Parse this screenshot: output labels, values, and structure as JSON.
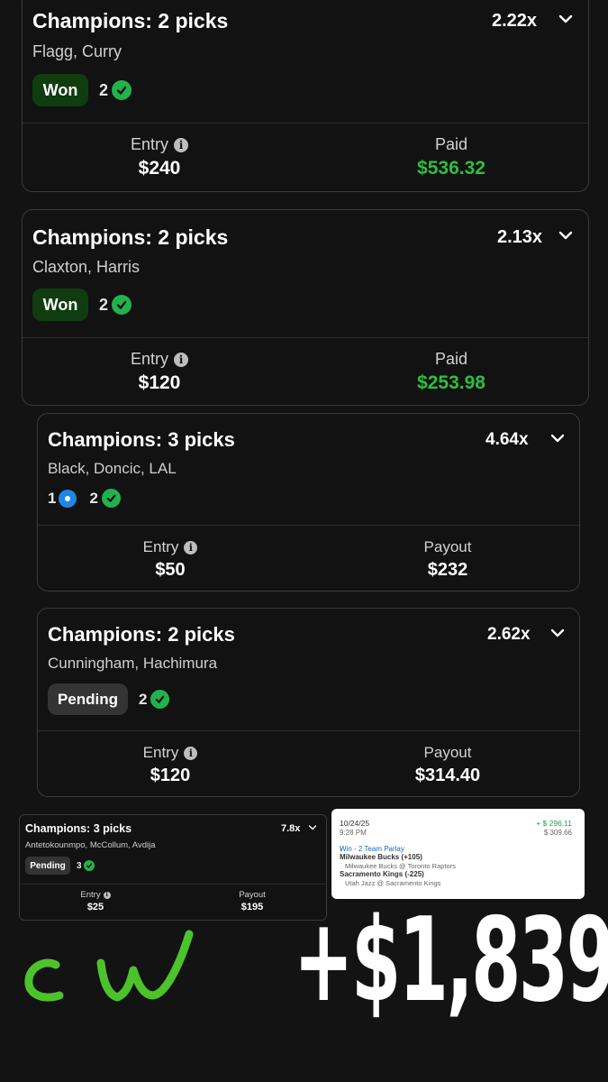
{
  "cards": [
    {
      "title": "Champions: 2 picks",
      "multiplier": "2.22x",
      "players": "Flagg, Curry",
      "badge": "Won",
      "pending_count": "",
      "check_count": "2",
      "entry_label": "Entry",
      "entry_value": "$240",
      "result_label": "Paid",
      "result_value": "$536.32"
    },
    {
      "title": "Champions: 2 picks",
      "multiplier": "2.13x",
      "players": "Claxton, Harris",
      "badge": "Won",
      "pending_count": "",
      "check_count": "2",
      "entry_label": "Entry",
      "entry_value": "$120",
      "result_label": "Paid",
      "result_value": "$253.98"
    },
    {
      "title": "Champions: 3 picks",
      "multiplier": "4.64x",
      "players": "Black, Doncic, LAL",
      "badge": "",
      "pending_count": "1",
      "check_count": "2",
      "entry_label": "Entry",
      "entry_value": "$50",
      "result_label": "Payout",
      "result_value": "$232"
    },
    {
      "title": "Champions: 2 picks",
      "multiplier": "2.62x",
      "players": "Cunningham, Hachimura",
      "badge": "Pending",
      "pending_count": "",
      "check_count": "2",
      "entry_label": "Entry",
      "entry_value": "$120",
      "result_label": "Payout",
      "result_value": "$314.40"
    },
    {
      "title": "Champions: 3 picks",
      "multiplier": "7.8x",
      "players": "Antetokounmpo, McCollum, Avdija",
      "badge": "Pending",
      "pending_count": "",
      "check_count": "3",
      "entry_label": "Entry",
      "entry_value": "$25",
      "result_label": "Payout",
      "result_value": "$195"
    }
  ],
  "receipt": {
    "date": "10/24/25",
    "time": "9:28 PM",
    "profit": "+ $ 296.11",
    "total": "$ 309.66",
    "bet_type": "Win - 2 Team Parlay",
    "pick1": "Milwaukee Bucks (+105)",
    "game1": "Milwaukee Bucks @ Toronto Raptors",
    "pick2": "Sacramento Kings (-225)",
    "game2": "Utah Jazz @ Sacramento Kings"
  },
  "handwriting": "cw",
  "total_text": "+$1,839",
  "colors": {
    "won_green": "#2fbe3e",
    "check_green": "#22b24c",
    "pending_blue": "#1e88e5",
    "handwriting_green": "#4cc32b"
  }
}
